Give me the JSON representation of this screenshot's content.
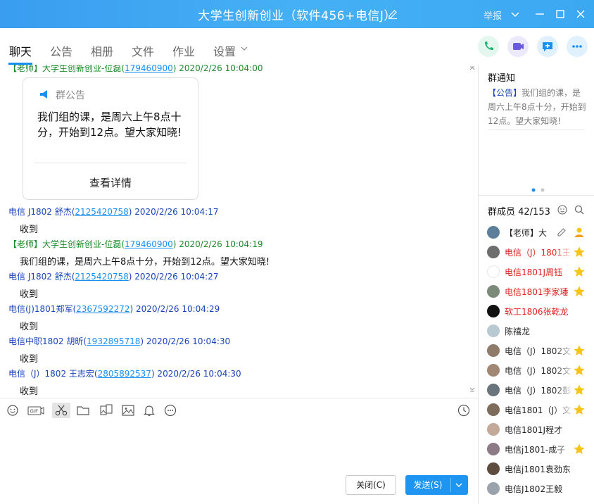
{
  "window": {
    "title": "大学生创新创业（软件456+电信J）",
    "report_label": "举报"
  },
  "tabs": [
    {
      "label": "聊天",
      "active": true
    },
    {
      "label": "公告"
    },
    {
      "label": "相册"
    },
    {
      "label": "文件"
    },
    {
      "label": "作业"
    },
    {
      "label": "设置"
    }
  ],
  "chat": {
    "first_meta": {
      "prefix": "【老师】大学生创新创业-位磊(",
      "uid": "179460900",
      "suffix": ") 2020/2/26 10:04:00"
    },
    "notice_card": {
      "title": "群公告",
      "body": "我们组的课，是周六上午8点十分，开始到12点。望大家知晓!",
      "detail_label": "查看详情"
    },
    "messages": [
      {
        "prefix": "电信 J1802 舒杰(",
        "uid": "2125420758",
        "suffix": ") 2020/2/26 10:04:17",
        "text": "收到",
        "color": "blue"
      },
      {
        "prefix": "【老师】大学生创新创业-位磊(",
        "uid": "179460900",
        "suffix": ") 2020/2/26 10:04:19",
        "text": "我们组的课，是周六上午8点十分，开始到12点。望大家知晓!",
        "color": "green"
      },
      {
        "prefix": "电信 J1802 舒杰(",
        "uid": "2125420758",
        "suffix": ") 2020/2/26 10:04:27",
        "text": "收到",
        "color": "blue"
      },
      {
        "prefix": "电信(J)1801郑军(",
        "uid": "2367592272",
        "suffix": ") 2020/2/26 10:04:29",
        "text": "收到",
        "color": "blue"
      },
      {
        "prefix": "电信中职1802 胡昕(",
        "uid": "1932895718",
        "suffix": ") 2020/2/26 10:04:30",
        "text": "收到",
        "color": "blue"
      },
      {
        "prefix": "电信（J）1802 王志宏(",
        "uid": "2805892537",
        "suffix": ") 2020/2/26 10:04:30",
        "text": "收到",
        "color": "blue"
      }
    ]
  },
  "toolbar": {
    "icons": [
      "emoji-icon",
      "gif-icon",
      "scissors-icon",
      "folder-icon",
      "image-gallery-icon",
      "picture-icon",
      "bell-icon",
      "more-icon",
      "history-clock-icon"
    ]
  },
  "buttons": {
    "close_label": "关闭(C)",
    "send_label": "发送(S)"
  },
  "right_panel": {
    "notice_title": "群通知",
    "notice_tag": "【公告】",
    "notice_text": "我们组的课，是周六上午8点十分，开始到12点。望大家知晓!",
    "members_title": "群成员 42/153",
    "members": [
      {
        "name": "【老师】大",
        "color": "dark"
      },
      {
        "name": "电信（J）1801王",
        "color": "red"
      },
      {
        "name": "电信1801J周钰",
        "color": "red"
      },
      {
        "name": "电信1801李家璠",
        "color": "red"
      },
      {
        "name": "软工1806张乾龙",
        "color": "red"
      },
      {
        "name": "陈禧龙",
        "color": "dark"
      },
      {
        "name": "电信（J）1802文",
        "color": "dark"
      },
      {
        "name": "电信（J）1802文",
        "color": "dark"
      },
      {
        "name": "电信（J）1802彭",
        "color": "dark"
      },
      {
        "name": "电信1801（J）文",
        "color": "dark"
      },
      {
        "name": "电信1801J程才",
        "color": "dark"
      },
      {
        "name": "电信j1801-成子",
        "color": "dark"
      },
      {
        "name": "电信j1801袁劲东",
        "color": "dark"
      },
      {
        "name": "电信J1802王毅",
        "color": "dark"
      }
    ]
  },
  "colors": {
    "title_bar": "#45b0f5",
    "accent": "#1a8ff0",
    "send_button": "#1f95f2",
    "sender_blue": "#1a44b8",
    "teacher_green": "#1d8a2c",
    "member_red": "#e02020",
    "star": "#f5c518"
  }
}
